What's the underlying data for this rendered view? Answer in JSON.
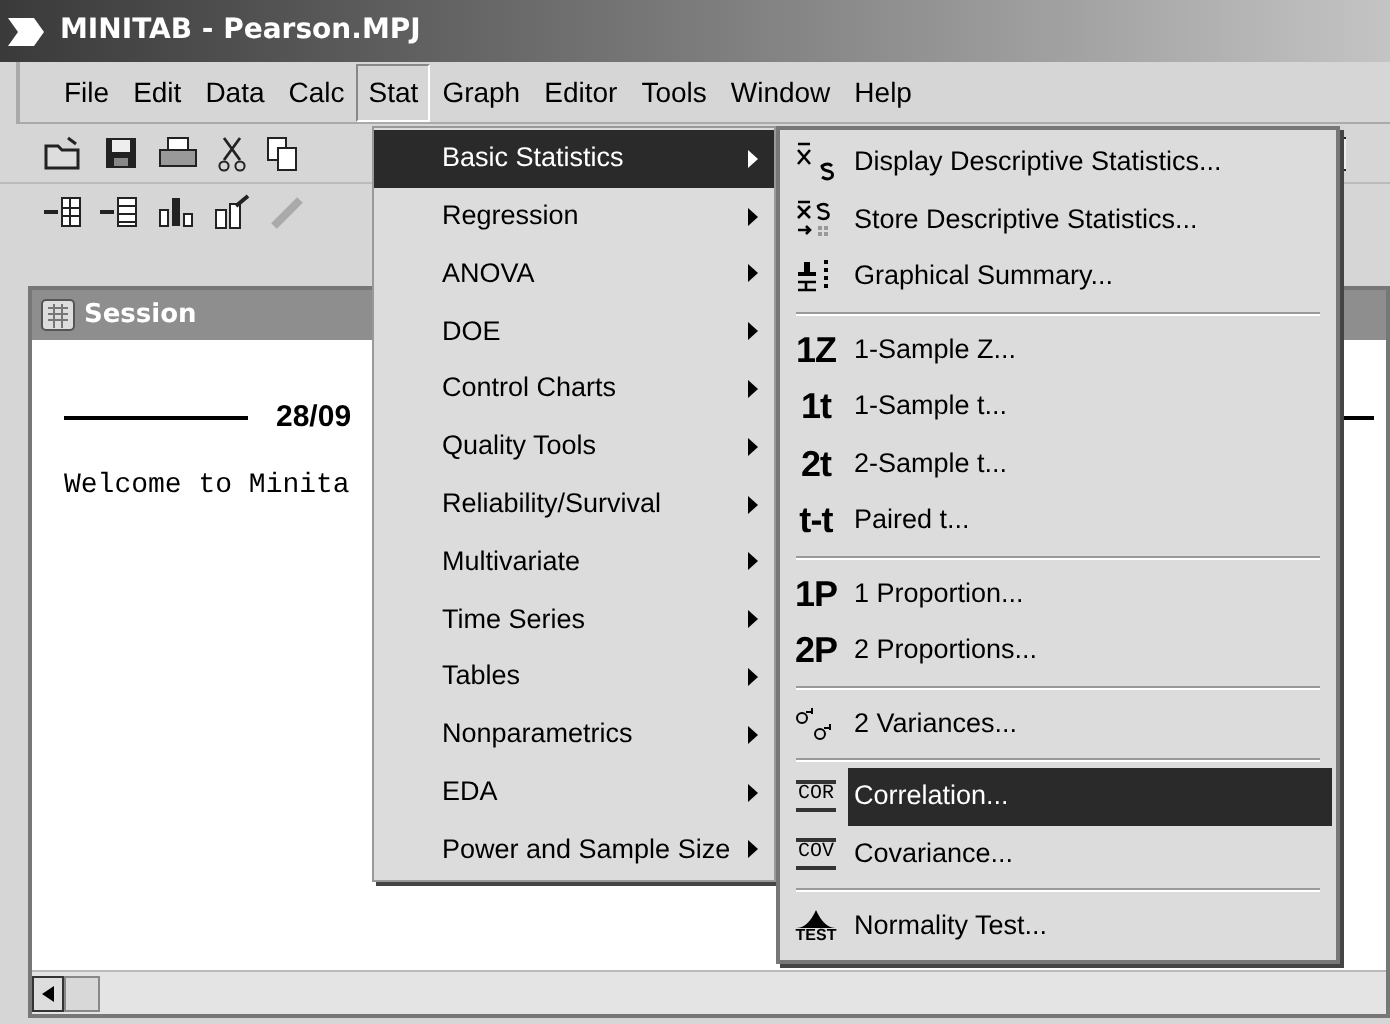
{
  "window": {
    "title": "MINITAB - Pearson.MPJ"
  },
  "menu_bar": [
    {
      "label": "File",
      "selected": false
    },
    {
      "label": "Edit",
      "selected": false
    },
    {
      "label": "Data",
      "selected": false
    },
    {
      "label": "Calc",
      "selected": false
    },
    {
      "label": "Stat",
      "selected": true
    },
    {
      "label": "Graph",
      "selected": false
    },
    {
      "label": "Editor",
      "selected": false
    },
    {
      "label": "Tools",
      "selected": false
    },
    {
      "label": "Window",
      "selected": false
    },
    {
      "label": "Help",
      "selected": false
    }
  ],
  "session": {
    "title": "Session",
    "date": "28/09",
    "text": "Welcome to Minita"
  },
  "stat_menu": [
    {
      "label": "Basic Statistics",
      "selected": true
    },
    {
      "label": "Regression",
      "selected": false
    },
    {
      "label": "ANOVA",
      "selected": false
    },
    {
      "label": "DOE",
      "selected": false
    },
    {
      "label": "Control Charts",
      "selected": false
    },
    {
      "label": "Quality Tools",
      "selected": false
    },
    {
      "label": "Reliability/Survival",
      "selected": false
    },
    {
      "label": "Multivariate",
      "selected": false
    },
    {
      "label": "Time Series",
      "selected": false
    },
    {
      "label": "Tables",
      "selected": false
    },
    {
      "label": "Nonparametrics",
      "selected": false
    },
    {
      "label": "EDA",
      "selected": false
    },
    {
      "label": "Power and Sample Size",
      "selected": false
    }
  ],
  "basic_statistics_menu": [
    {
      "kind": "xbar-s",
      "label": "Display Descriptive Statistics...",
      "selected": false
    },
    {
      "kind": "xbar-s-store",
      "label": "Store Descriptive Statistics...",
      "selected": false
    },
    {
      "kind": "summary",
      "label": "Graphical Summary...",
      "selected": false
    },
    {
      "kind": "separator"
    },
    {
      "kind": "text",
      "icon_text": "1Z",
      "label": "1-Sample Z...",
      "selected": false
    },
    {
      "kind": "text",
      "icon_text": "1t",
      "label": "1-Sample t...",
      "selected": false
    },
    {
      "kind": "text",
      "icon_text": "2t",
      "label": "2-Sample t...",
      "selected": false
    },
    {
      "kind": "text",
      "icon_text": "t-t",
      "label": "Paired t...",
      "selected": false
    },
    {
      "kind": "separator"
    },
    {
      "kind": "text",
      "icon_text": "1P",
      "label": "1 Proportion...",
      "selected": false
    },
    {
      "kind": "text",
      "icon_text": "2P",
      "label": "2 Proportions...",
      "selected": false
    },
    {
      "kind": "separator"
    },
    {
      "kind": "variance",
      "label": "2 Variances...",
      "selected": false
    },
    {
      "kind": "separator"
    },
    {
      "kind": "boxed",
      "icon_text": "COR",
      "label": "Correlation...",
      "selected": true
    },
    {
      "kind": "boxed",
      "icon_text": "COV",
      "label": "Covariance...",
      "selected": false
    },
    {
      "kind": "separator"
    },
    {
      "kind": "test",
      "icon_text": "TEST",
      "label": "Normality Test...",
      "selected": false
    }
  ]
}
